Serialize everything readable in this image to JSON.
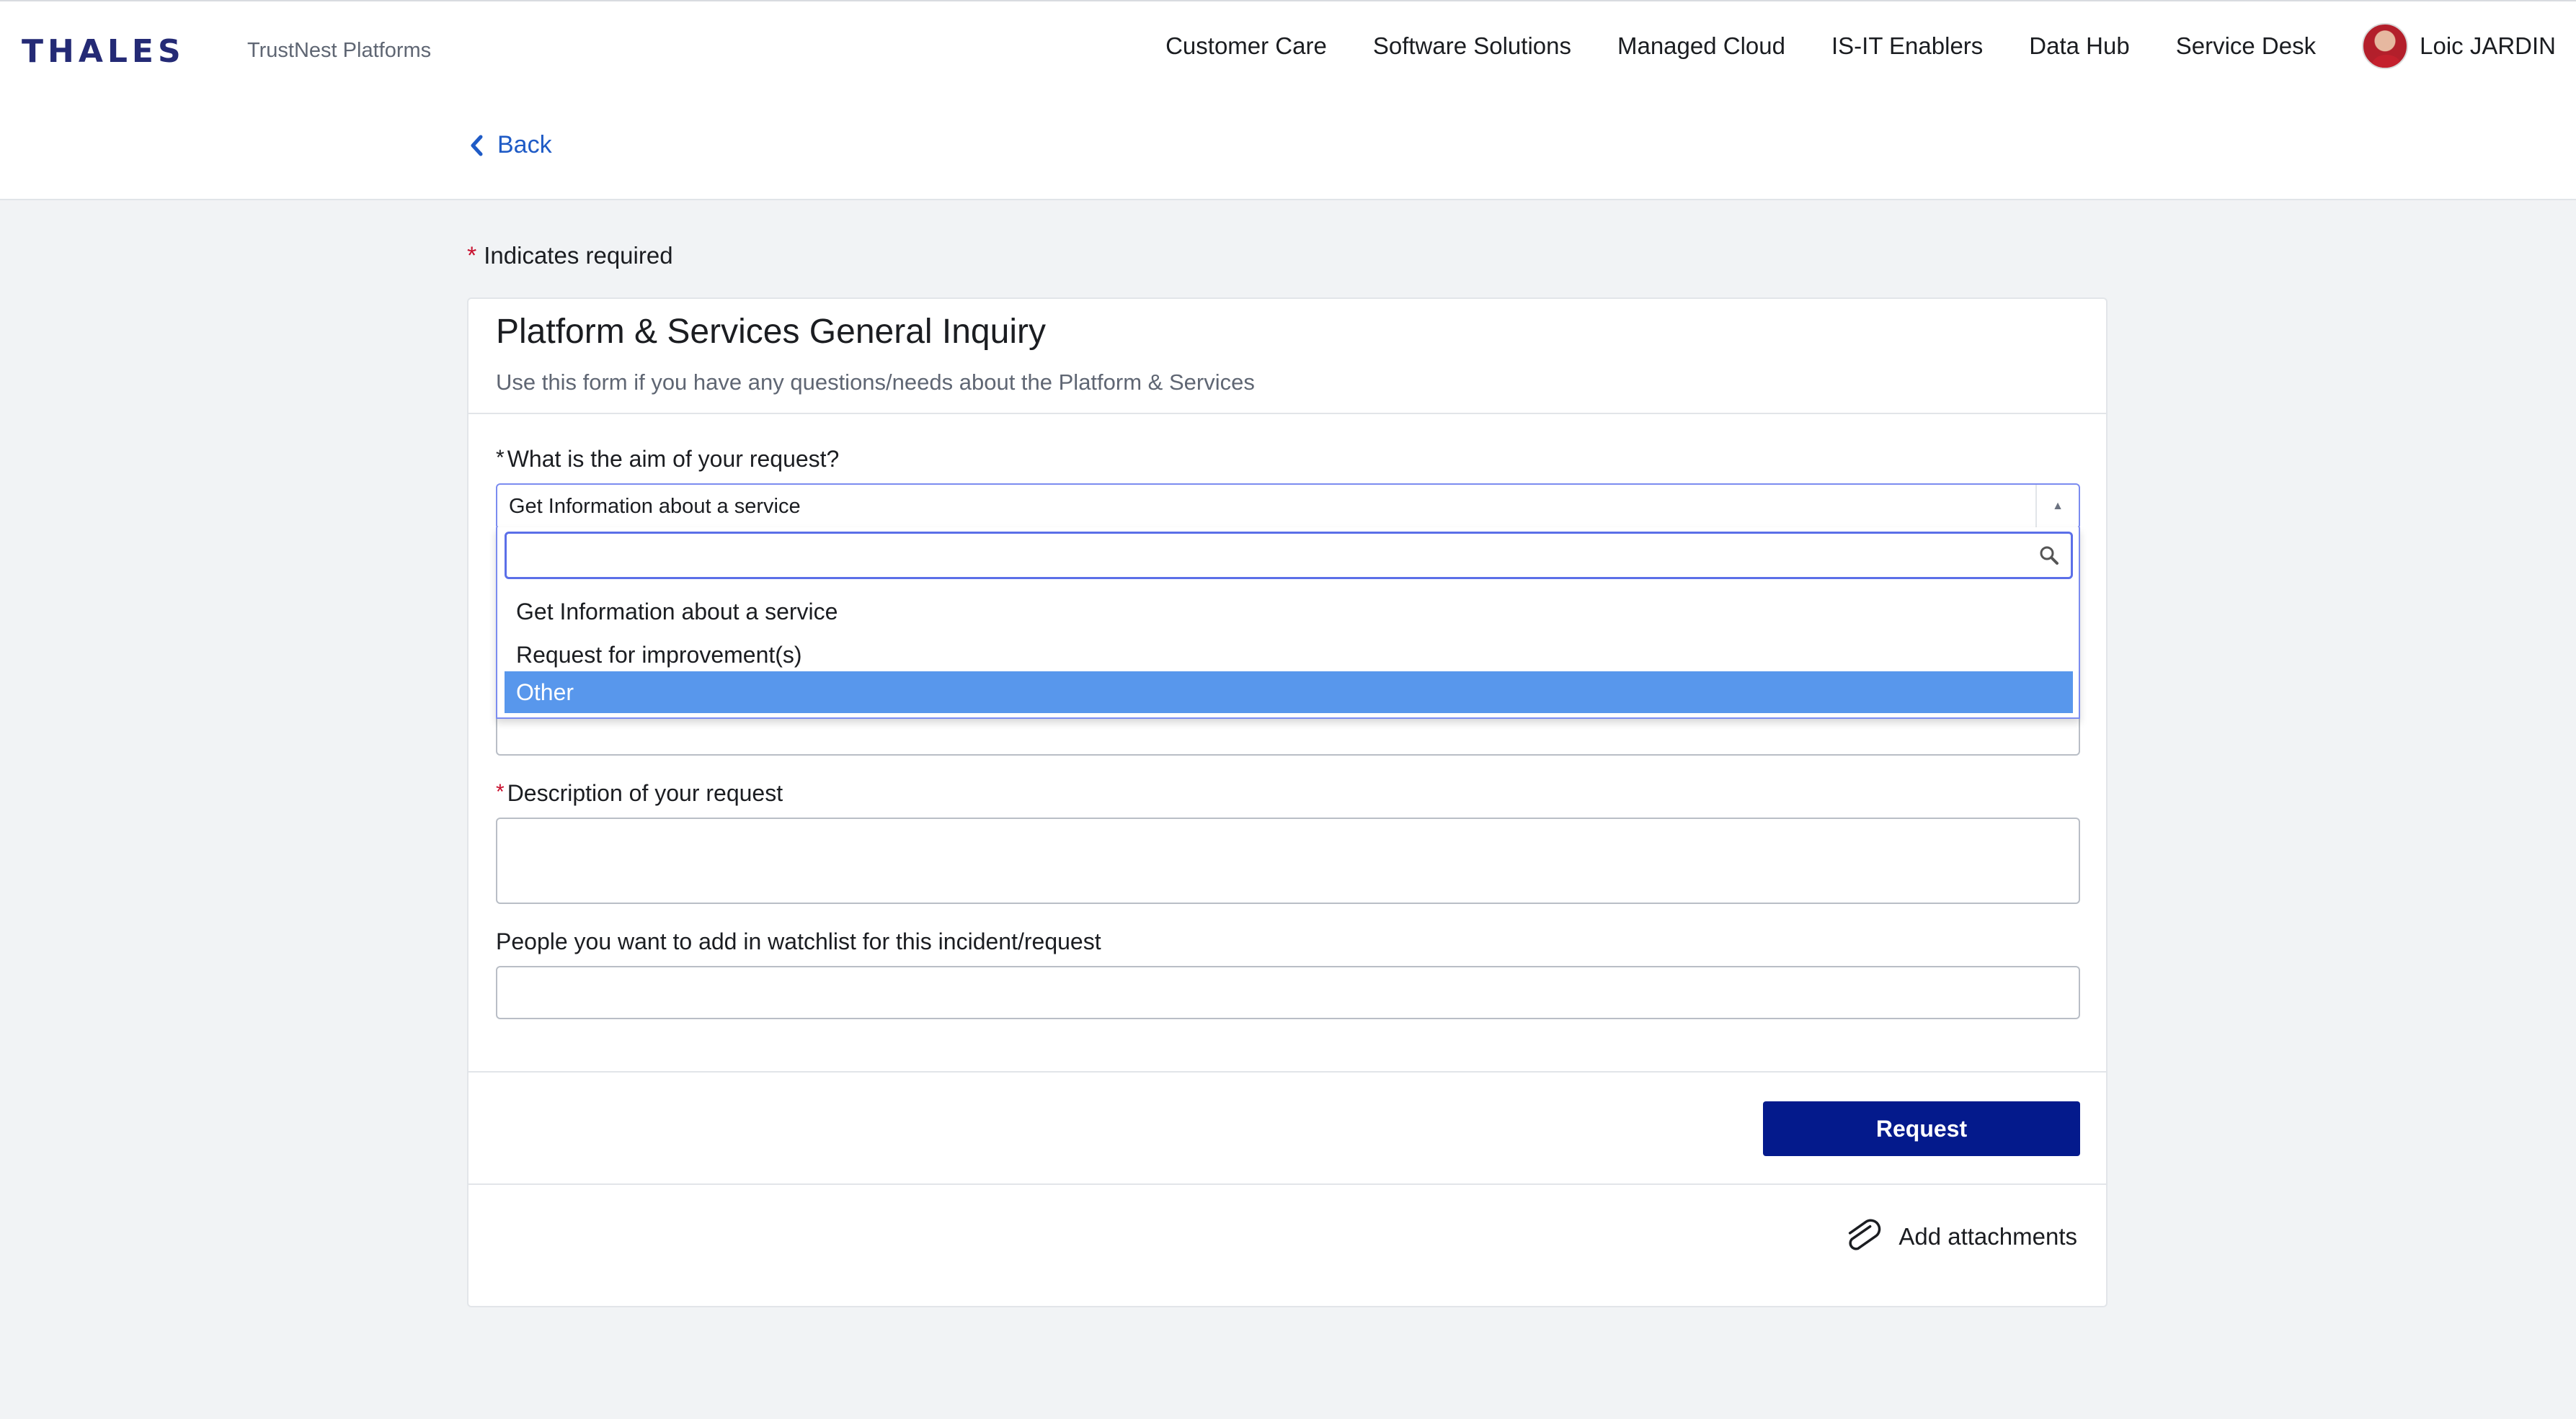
{
  "header": {
    "logo": "THALES",
    "brand": "TrustNest Platforms",
    "nav": [
      "Customer Care",
      "Software Solutions",
      "Managed Cloud",
      "IS-IT Enablers",
      "Data Hub",
      "Service Desk"
    ],
    "user_name": "Loic JARDIN",
    "back_label": "Back"
  },
  "form": {
    "required_note": "Indicates required",
    "title": "Platform & Services General Inquiry",
    "subtitle": "Use this form if you have any questions/needs about the Platform & Services",
    "aim": {
      "label": "What is the aim of your request?",
      "value": "Get Information about a service",
      "options": [
        "Get Information about a service",
        "Request for improvement(s)",
        "Other"
      ],
      "highlighted": "Other"
    },
    "description_label": "Description of your request",
    "watchlist_label": "People you want to add in watchlist for this incident/request",
    "submit_label": "Request",
    "attachments_label": "Add attachments"
  },
  "colors": {
    "brand": "#242a75",
    "primary_button": "#041a8c",
    "link": "#1f5bc6",
    "highlight": "#5897ec",
    "required": "#c8102e"
  }
}
